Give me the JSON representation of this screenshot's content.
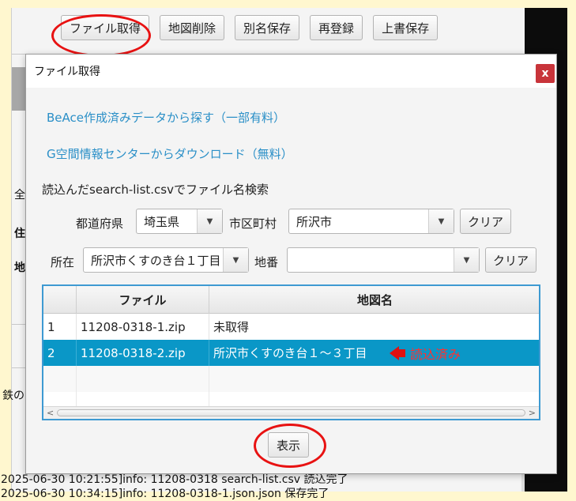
{
  "toolbar": {
    "buttons": [
      "ファイル取得",
      "地図削除",
      "別名保存",
      "再登録",
      "上書保存"
    ]
  },
  "background": {
    "fragments": [
      "全",
      "住",
      "地",
      "鉄の"
    ],
    "log_lines": [
      "2025-06-30 10:21:55]info: 11208-0318 search-list.csv 読込完了",
      "2025-06-30 10:34:15]info: 11208-0318-1.json.json 保存完了"
    ]
  },
  "dialog": {
    "title": "ファイル取得",
    "close_label": "x",
    "links": {
      "beace": "BeAce作成済みデータから探す（一部有料）",
      "gkukan": "G空間情報センターからダウンロード（無料）"
    },
    "search_heading": "読込んだsearch-list.csvでファイル名検索",
    "prefecture": {
      "label": "都道府県",
      "value": "埼玉県"
    },
    "city": {
      "label": "市区町村",
      "value": "所沢市"
    },
    "clear_label": "クリア",
    "location": {
      "label": "所在",
      "value": "所沢市くすのき台１丁目"
    },
    "chiban": {
      "label": "地番",
      "value": ""
    },
    "table": {
      "columns": [
        "",
        "ファイル",
        "地図名"
      ],
      "rows": [
        {
          "no": "1",
          "file": "11208-0318-1.zip",
          "map": "未取得"
        },
        {
          "no": "2",
          "file": "11208-0318-2.zip",
          "map": "所沢市くすのき台１～３丁目"
        }
      ],
      "selected_row": 2,
      "annotation": "読込済み"
    },
    "show_button": "表示"
  },
  "colors": {
    "accent": "#0a97c7",
    "link": "#2a8fc7",
    "annotation_red": "#e81212",
    "close_red": "#c8343a",
    "background_yellow": "#fff7cf"
  }
}
